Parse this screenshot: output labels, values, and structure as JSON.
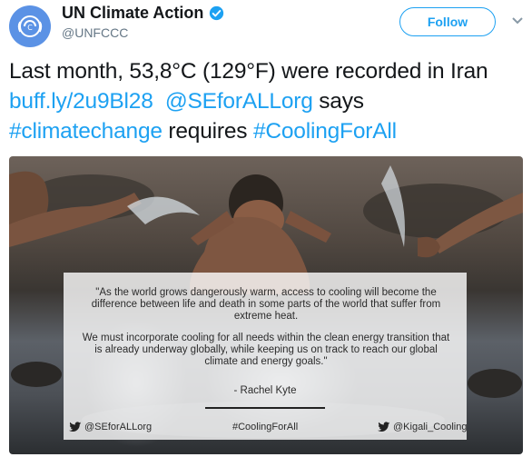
{
  "account": {
    "display_name": "UN Climate Action",
    "handle": "@UNFCCC",
    "avatar_icon": "un-climate-logo-icon",
    "verified_icon": "verified-badge-icon"
  },
  "follow_button": {
    "label": "Follow"
  },
  "menu_icon": "chevron-down-icon",
  "tweet": {
    "text_part1": "Last month, 53,8°C (129°F) were recorded in Iran ",
    "link_url": "buff.ly/2u9Bl28",
    "space1": "  ",
    "mention": "@SEforALLorg",
    "text_part2": " says ",
    "hashtag1": "#climatechange",
    "text_part3": " requires ",
    "hashtag2": "#CoolingForAll"
  },
  "media": {
    "quote_paragraph1": "\"As the world grows dangerously warm, access to cooling will become the difference between life and death in some parts of the world that suffer from extreme heat.",
    "quote_paragraph2": "We must incorporate cooling for all needs within the clean energy transition that is already underway globally, while keeping us on track to reach our global climate and energy goals.\"",
    "attribution": "- Rachel Kyte",
    "footer_left": "@SEforALLorg",
    "footer_center": "#CoolingForAll",
    "footer_right": "@Kigali_Cooling"
  },
  "colors": {
    "link": "#1da1f2",
    "text": "#14171a",
    "muted": "#657786",
    "avatar": "#5b92e5"
  }
}
